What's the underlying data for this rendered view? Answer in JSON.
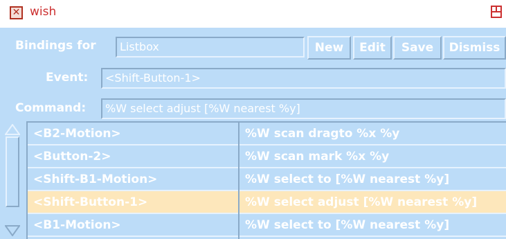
{
  "titlebar": {
    "title": "wish",
    "icon": "tk-app-icon",
    "maximize_icon": "maximize-icon"
  },
  "header": {
    "label": "Bindings for",
    "widget_value": "Listbox",
    "buttons": [
      "New",
      "Edit",
      "Save",
      "Dismiss"
    ]
  },
  "event": {
    "label": "Event:",
    "value": "<Shift-Button-1>"
  },
  "command": {
    "label": "Command:",
    "value": "%W select adjust [%W nearest %y]"
  },
  "bindings": {
    "events": [
      "<B2-Motion>",
      "<Button-2>",
      "<Shift-B1-Motion>",
      "<Shift-Button-1>",
      "<B1-Motion>"
    ],
    "commands": [
      "%W scan dragto %x %y",
      "%W scan mark %x %y",
      "%W select to [%W nearest %y]",
      "%W select adjust [%W nearest %y]",
      "%W select to [%W nearest %y]"
    ],
    "selected_index": 3
  },
  "colors": {
    "background": "#bcdcf8",
    "selection": "#fde7bb",
    "title_text": "#cc3030"
  }
}
